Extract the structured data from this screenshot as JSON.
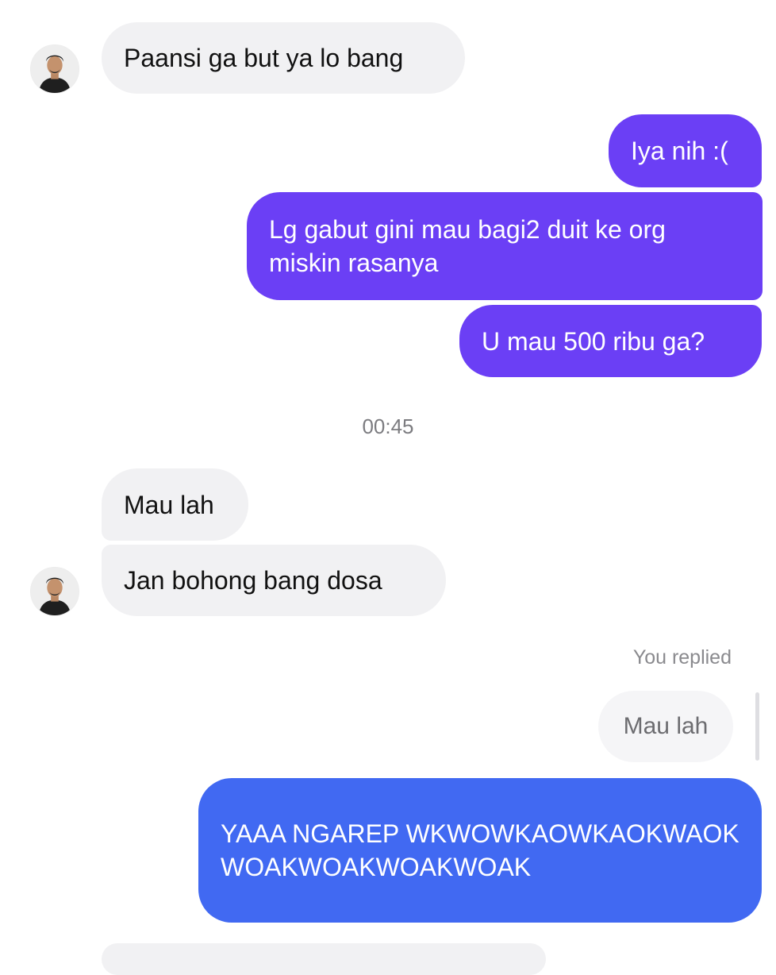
{
  "messages": {
    "m1": "Paansi ga but ya lo bang",
    "m2": "Iya nih :(",
    "m3": "Lg gabut gini mau bagi2 duit ke org miskin rasanya",
    "m4": "U mau 500 ribu ga?",
    "m5": "Mau lah",
    "m6": "Jan bohong bang dosa",
    "m7": "YAAA NGAREP WKWOWKAOWKAOKWAOKWOAKWOAKWOAKWOAK"
  },
  "timestamp": "00:45",
  "reply": {
    "label": "You replied",
    "quoted_text": "Mau lah"
  },
  "colors": {
    "incoming_bubble": "#f1f1f3",
    "outgoing_bubble": "#6b3ff5",
    "outgoing_bubble_latest": "#4169f2"
  },
  "icons": {
    "avatar": "contact-avatar"
  }
}
